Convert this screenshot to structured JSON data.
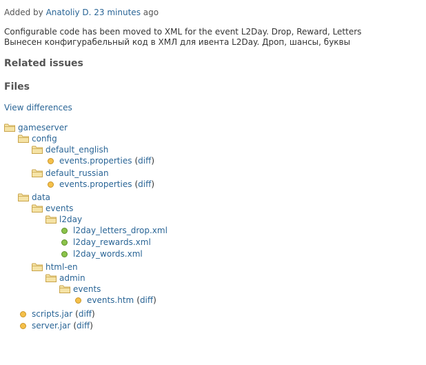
{
  "journal": {
    "added_prefix": "Added by",
    "author": "Anatoliy D.",
    "time_ago": "23 minutes",
    "ago_suffix": "ago",
    "description_line1": "Configurable code has been moved to XML for the event L2Day. Drop, Reward, Letters",
    "description_line2": "Вынесен конфигурабельный код в ХМЛ для ивента L2Day. Дроп, шансы, буквы"
  },
  "sections": {
    "related_issues": "Related issues",
    "files": "Files",
    "view_differences": "View differences"
  },
  "tree": {
    "diff_label": "diff",
    "items": [
      {
        "kind": "folder",
        "label": "gameserver"
      },
      {
        "kind": "folder",
        "label": "config"
      },
      {
        "kind": "folder",
        "label": "default_english"
      },
      {
        "kind": "file",
        "label": "events.properties",
        "status": "modified",
        "diff": true
      },
      {
        "kind": "folder",
        "label": "default_russian"
      },
      {
        "kind": "file",
        "label": "events.properties",
        "status": "modified",
        "diff": true
      },
      {
        "kind": "folder",
        "label": "data"
      },
      {
        "kind": "folder",
        "label": "events"
      },
      {
        "kind": "folder",
        "label": "l2day"
      },
      {
        "kind": "file",
        "label": "l2day_letters_drop.xml",
        "status": "added",
        "diff": false
      },
      {
        "kind": "file",
        "label": "l2day_rewards.xml",
        "status": "added",
        "diff": false
      },
      {
        "kind": "file",
        "label": "l2day_words.xml",
        "status": "added",
        "diff": false
      },
      {
        "kind": "folder",
        "label": "html-en"
      },
      {
        "kind": "folder",
        "label": "admin"
      },
      {
        "kind": "folder",
        "label": "events"
      },
      {
        "kind": "file",
        "label": "events.htm",
        "status": "modified",
        "diff": true
      },
      {
        "kind": "file",
        "label": "scripts.jar",
        "status": "modified",
        "diff": true
      },
      {
        "kind": "file",
        "label": "server.jar",
        "status": "modified",
        "diff": true
      }
    ]
  },
  "colors": {
    "link": "#2a6596",
    "modified_bullet": "#f5c04a",
    "added_bullet": "#8bc34a",
    "folder_fill": "#f5e3a6",
    "folder_stroke": "#c9a44a"
  }
}
